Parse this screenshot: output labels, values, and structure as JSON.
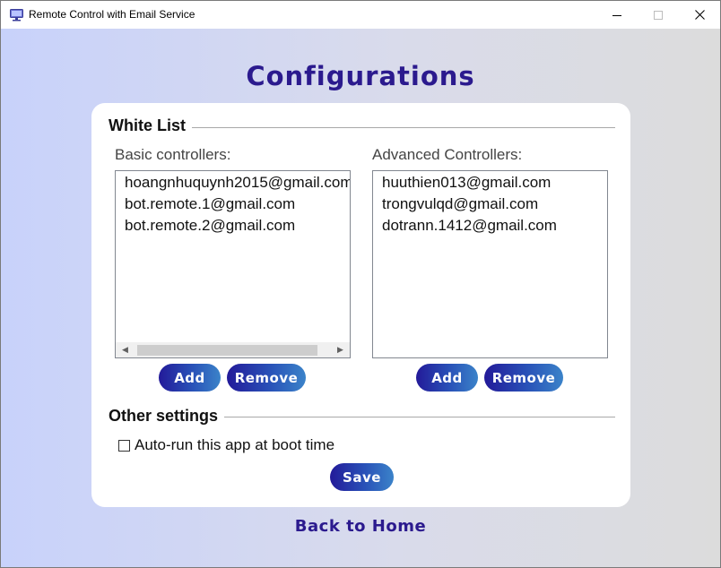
{
  "window": {
    "title": "Remote Control with Email Service"
  },
  "page": {
    "title": "Configurations",
    "back_label": "Back to Home"
  },
  "white_list": {
    "section_title": "White List",
    "basic": {
      "label": "Basic controllers:",
      "items": [
        "hoangnhuquynh2015@gmail.com",
        "bot.remote.1@gmail.com",
        "bot.remote.2@gmail.com"
      ],
      "add_label": "Add",
      "remove_label": "Remove"
    },
    "advanced": {
      "label": "Advanced Controllers:",
      "items": [
        "huuthien013@gmail.com",
        "trongvulqd@gmail.com",
        "dotrann.1412@gmail.com"
      ],
      "add_label": "Add",
      "remove_label": "Remove"
    }
  },
  "other_settings": {
    "section_title": "Other settings",
    "autorun_label": "Auto-run this app at boot time",
    "autorun_checked": false,
    "save_label": "Save"
  },
  "colors": {
    "accent_dark": "#231a99",
    "accent_light": "#3b83c9",
    "title_color": "#2b1a8e"
  }
}
